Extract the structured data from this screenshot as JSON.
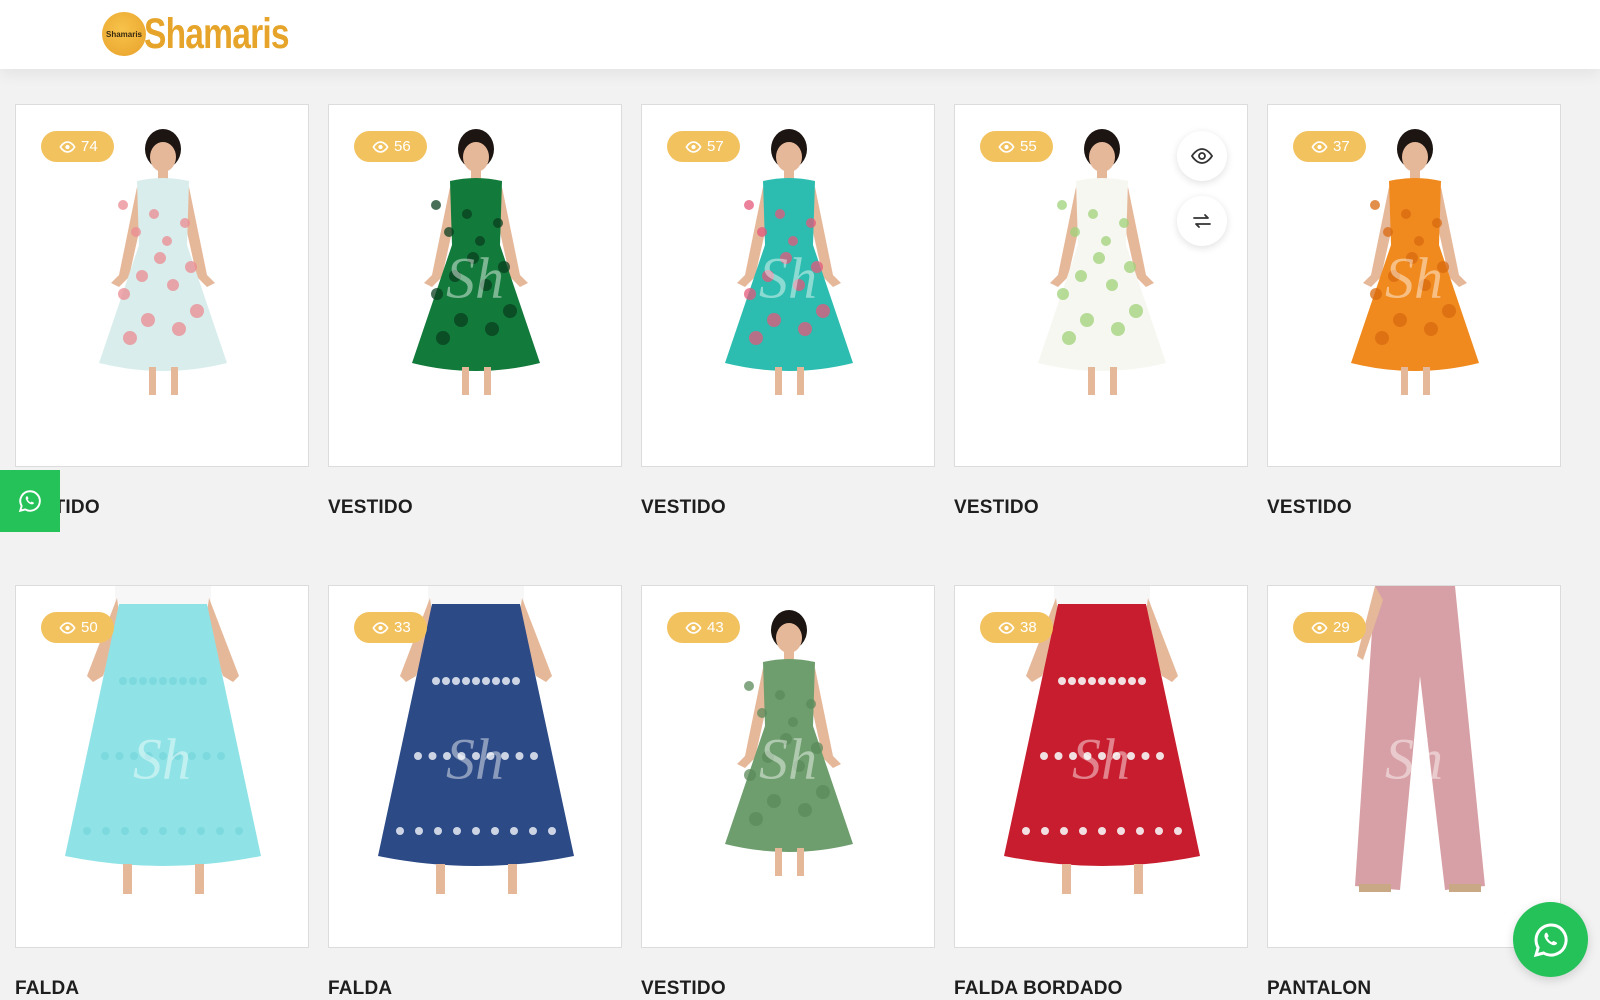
{
  "brand": {
    "logo_badge_text": "Shamaris",
    "logo_text": "Shamaris",
    "accent": "#f2c25f",
    "whatsapp_green": "#25c25a"
  },
  "products": [
    {
      "title": "VESTIDO",
      "views": "74",
      "garment": "dress",
      "colors": [
        "#d9eeec",
        "#e98b92"
      ]
    },
    {
      "title": "VESTIDO",
      "views": "56",
      "garment": "dress",
      "colors": [
        "#127a3a",
        "#0a3f1f"
      ]
    },
    {
      "title": "VESTIDO",
      "views": "57",
      "garment": "dress",
      "colors": [
        "#2dbdb0",
        "#e4577a"
      ]
    },
    {
      "title": "VESTIDO",
      "views": "55",
      "garment": "dress",
      "colors": [
        "#f6f7f0",
        "#9fd27a"
      ]
    },
    {
      "title": "VESTIDO",
      "views": "37",
      "garment": "dress",
      "colors": [
        "#f08a1e",
        "#d86a10"
      ]
    },
    {
      "title": "FALDA",
      "views": "50",
      "garment": "skirt",
      "colors": [
        "#8fe3e6",
        "#7ad7dc"
      ]
    },
    {
      "title": "FALDA",
      "views": "33",
      "garment": "skirt",
      "colors": [
        "#2c4a86",
        "#dfe4ef"
      ]
    },
    {
      "title": "VESTIDO",
      "views": "43",
      "garment": "dress",
      "colors": [
        "#6e9e6d",
        "#5b8a5a"
      ]
    },
    {
      "title": "FALDA BORDADO",
      "views": "38",
      "garment": "skirt",
      "colors": [
        "#c81d2e",
        "#f5f5f5"
      ]
    },
    {
      "title": "PANTALON",
      "views": "29",
      "garment": "pants",
      "colors": [
        "#d7a0a6",
        "#c88e95"
      ]
    }
  ],
  "icons": {
    "views": "eye-icon",
    "quick_view": "eye-icon",
    "compare": "compare-icon",
    "whatsapp": "whatsapp-icon"
  },
  "watermark_text": "Sh"
}
